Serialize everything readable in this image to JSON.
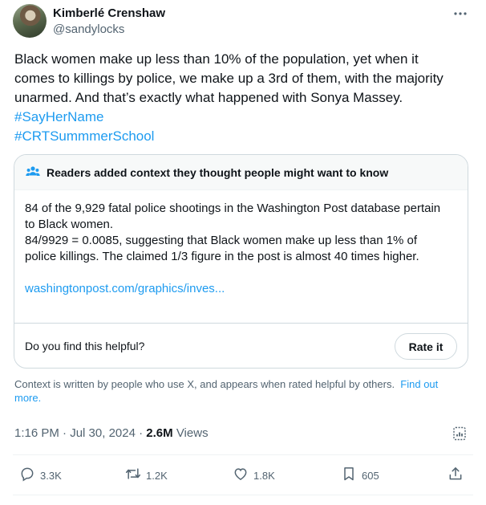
{
  "author": {
    "display_name": "Kimberlé Crenshaw",
    "handle": "@sandylocks"
  },
  "tweet": {
    "lines": [
      "Black women make up less than 10% of the population, yet when it",
      "comes to killings by police, we make up a 3rd of them, with the majority",
      "unarmed. And that’s exactly what happened with Sonya Massey."
    ],
    "hashtags": [
      "#SayHerName",
      "#CRTSummmerSchool"
    ]
  },
  "community_note": {
    "header": "Readers added context they thought people might want to know",
    "paragraph1": [
      "84 of the 9,929 fatal police shootings in the Washington Post database pertain",
      "to Black women."
    ],
    "paragraph2": [
      "84/9929 = 0.0085, suggesting that Black women make up less than 1% of",
      "police killings. The claimed 1/3 figure in the post is almost 40 times higher."
    ],
    "link": "washingtonpost.com/graphics/inves...",
    "helpful_question": "Do you find this helpful?",
    "rate_button": "Rate it"
  },
  "disclaimer": {
    "text": "Context is written by people who use X, and appears when rated helpful by others.",
    "find_out": "Find out",
    "more": "more."
  },
  "meta": {
    "time": "1:16 PM",
    "separator1": " · ",
    "date": "Jul 30, 2024",
    "separator2": " · ",
    "views_count": "2.6M",
    "views_label": " Views"
  },
  "actions": {
    "replies": "3.3K",
    "retweets": "1.2K",
    "likes": "1.8K",
    "bookmarks": "605"
  },
  "colors": {
    "link": "#1d9bf0",
    "secondary_text": "#536471",
    "border": "#cfd9de",
    "note_header_bg": "#f7f9f9"
  },
  "icons": {
    "more": "more-icon",
    "readers": "people-icon",
    "analytics": "analytics-icon",
    "reply": "reply-icon",
    "retweet": "retweet-icon",
    "like": "heart-icon",
    "bookmark": "bookmark-icon",
    "share": "share-icon"
  }
}
